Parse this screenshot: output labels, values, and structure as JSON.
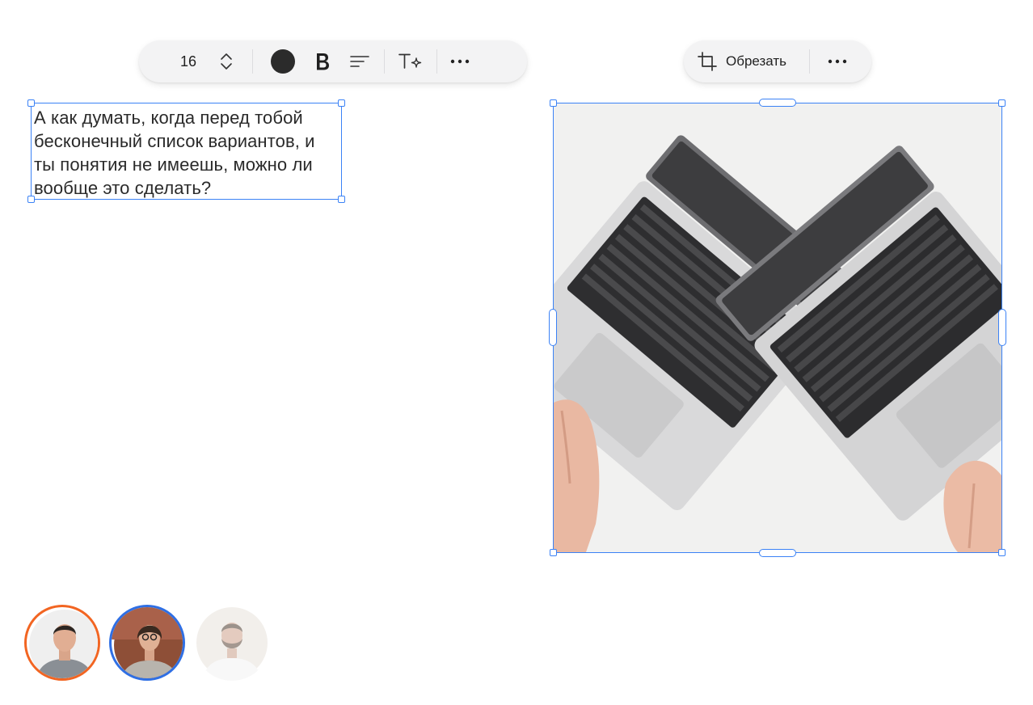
{
  "text_toolbar": {
    "font_size": "16",
    "text_color": "#2b2b2b",
    "icons": {
      "stepper": "up-down-chevron-icon",
      "bold": "bold-icon",
      "align": "align-left-icon",
      "text_ai": "text-sparkle-icon",
      "more": "more-horizontal-icon"
    }
  },
  "image_toolbar": {
    "crop_label": "Обрезать",
    "icons": {
      "crop": "crop-icon",
      "more": "more-horizontal-icon"
    }
  },
  "text_block": {
    "content": "А как думать, когда перед тобой бесконечный список вариантов, и ты понятия не имеешь, можно ли вообще это сделать?"
  },
  "image": {
    "description_icon": "laptops-photo"
  },
  "collaborators": [
    {
      "ring_color": "#f26522",
      "name_icon": "avatar-man"
    },
    {
      "ring_color": "#2f6fe4",
      "name_icon": "avatar-woman"
    },
    {
      "ring_color": "",
      "name_icon": "avatar-man-bearded"
    }
  ],
  "colors": {
    "selection": "#3b82f6"
  }
}
